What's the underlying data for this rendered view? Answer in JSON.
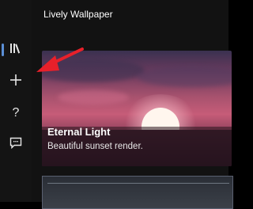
{
  "app": {
    "title": "Lively Wallpaper"
  },
  "sidebar": {
    "items": [
      {
        "icon": "library-icon",
        "selected": true
      },
      {
        "icon": "add-icon",
        "selected": false
      },
      {
        "icon": "help-icon",
        "selected": false
      },
      {
        "icon": "feedback-icon",
        "selected": false
      }
    ]
  },
  "wallpapers": [
    {
      "title": "Eternal Light",
      "description": "Beautiful sunset render."
    }
  ],
  "colors": {
    "accent": "#5b8fd6",
    "annotation_arrow": "#e8202a"
  }
}
